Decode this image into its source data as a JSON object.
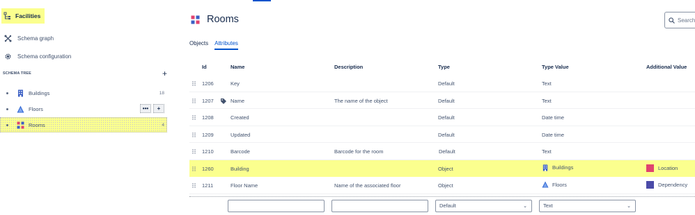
{
  "sidebar": {
    "facilities_label": "Facilities",
    "nav": [
      {
        "label": "Schema graph",
        "icon": "schema-graph-icon"
      },
      {
        "label": "Schema configuration",
        "icon": "gear-icon"
      }
    ],
    "schema_tree_label": "SCHEMA TREE",
    "tree": [
      {
        "label": "Buildings",
        "count": "18",
        "icon": "building-icon"
      },
      {
        "label": "Floors",
        "count": "",
        "icon": "floors-icon"
      },
      {
        "label": "Rooms",
        "count": "4",
        "icon": "rooms-icon"
      }
    ]
  },
  "main": {
    "title": "Rooms",
    "search_placeholder": "Search",
    "tabs": [
      "Objects",
      "Attributes"
    ],
    "active_tab": "Attributes",
    "columns": [
      "Id",
      "Name",
      "Description",
      "Type",
      "Type Value",
      "Additional Value"
    ],
    "rows": [
      {
        "id": "1206",
        "name": "Key",
        "description": "",
        "type": "Default",
        "type_value": "Text",
        "additional": ""
      },
      {
        "id": "1207",
        "name": "Name",
        "description": "The name of the object",
        "type": "Default",
        "type_value": "Text",
        "additional": ""
      },
      {
        "id": "1208",
        "name": "Created",
        "description": "",
        "type": "Default",
        "type_value": "Date time",
        "additional": ""
      },
      {
        "id": "1209",
        "name": "Updated",
        "description": "",
        "type": "Default",
        "type_value": "Date time",
        "additional": ""
      },
      {
        "id": "1210",
        "name": "Barcode",
        "description": "Barcode for the room",
        "type": "Default",
        "type_value": "Text",
        "additional": ""
      },
      {
        "id": "1260",
        "name": "Building",
        "description": "",
        "type": "Object",
        "type_value": "Buildings",
        "additional": "Location"
      },
      {
        "id": "1211",
        "name": "Floor Name",
        "description": "Name of the associated floor",
        "type": "Object",
        "type_value": "Floors",
        "additional": "Dependency"
      }
    ],
    "new_row": {
      "name": "",
      "description": "",
      "type": "Default",
      "type_value": "Text"
    }
  },
  "colors": {
    "highlight": "#fbff8e",
    "accent": "#0052cc",
    "location_swatch": "#e0436f",
    "dependency_swatch": "#4b4ba8"
  }
}
